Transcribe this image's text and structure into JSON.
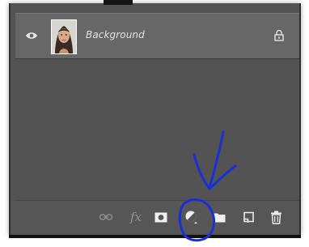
{
  "layers_panel": {
    "layer": {
      "name": "Background",
      "visible_icon": "eye-icon",
      "thumbnail": "portrait-thumbnail",
      "lock_icon": "lock-icon"
    },
    "toolbar": {
      "icons": [
        "link-layers-icon",
        "fx-icon",
        "add-mask-icon",
        "adjustment-layer-icon",
        "new-group-folder-icon",
        "new-layer-icon",
        "delete-layer-icon"
      ],
      "fx_label": "fx"
    }
  },
  "colors": {
    "panel_bg": "#535353",
    "row_bg": "#676767",
    "annotation_blue": "#1a2fd8"
  }
}
